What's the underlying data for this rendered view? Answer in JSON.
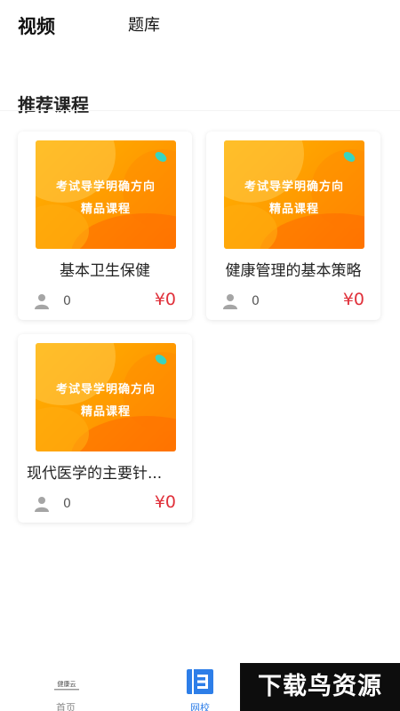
{
  "top_tabs": {
    "video": "视频",
    "question_bank": "题库"
  },
  "section": {
    "title": "推荐课程"
  },
  "thumbnail": {
    "line1": "考试导学明确方向",
    "line2": "精品课程"
  },
  "courses": [
    {
      "title": "基本卫生保健",
      "students": "0",
      "price": "¥0"
    },
    {
      "title": "健康管理的基本策略",
      "students": "0",
      "price": "¥0"
    },
    {
      "title": "现代医学的主要针...",
      "students": "0",
      "price": "¥0"
    }
  ],
  "bottom_nav": {
    "home_label": "首页",
    "home_logo_text": "健康云",
    "school_label": "网校"
  },
  "watermark": "下载鸟资源",
  "colors": {
    "price": "#e0303a",
    "active_nav": "#2d7ee8",
    "thumb_orange": "#ff9a00"
  }
}
